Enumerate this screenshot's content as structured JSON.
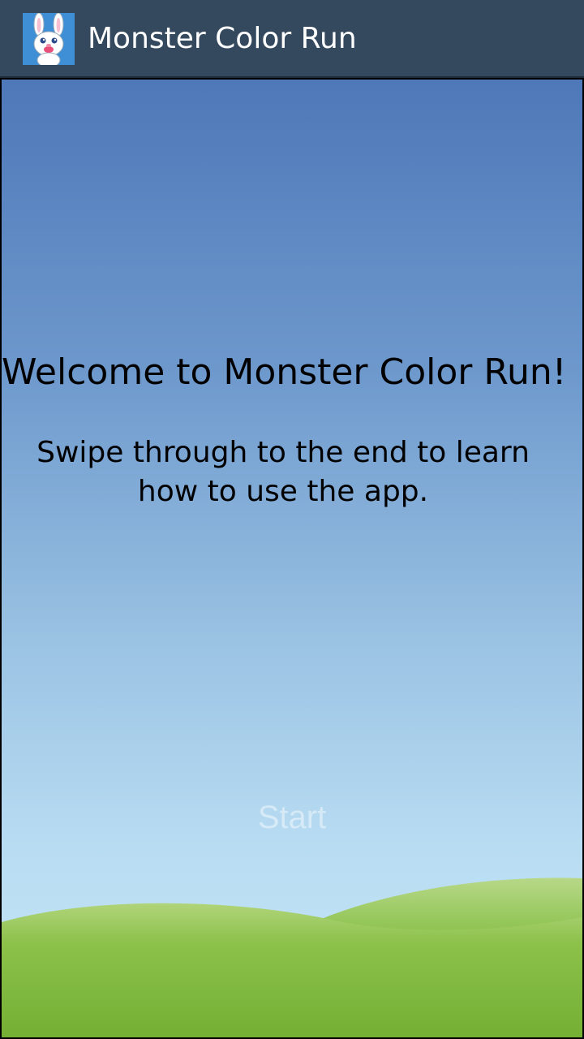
{
  "app_bar": {
    "title": "Monster Color Run",
    "icon": "bunny-app-icon",
    "bg_color": "#34495e"
  },
  "onboarding": {
    "title": "Welcome to Monster Color Run!",
    "subtitle": "Swipe through to the end to learn how to use the app.",
    "start_label": "Start"
  },
  "colors": {
    "sky_top": "#4e78b8",
    "sky_bottom": "#c6e6f7",
    "grass": "#7ab33f"
  }
}
